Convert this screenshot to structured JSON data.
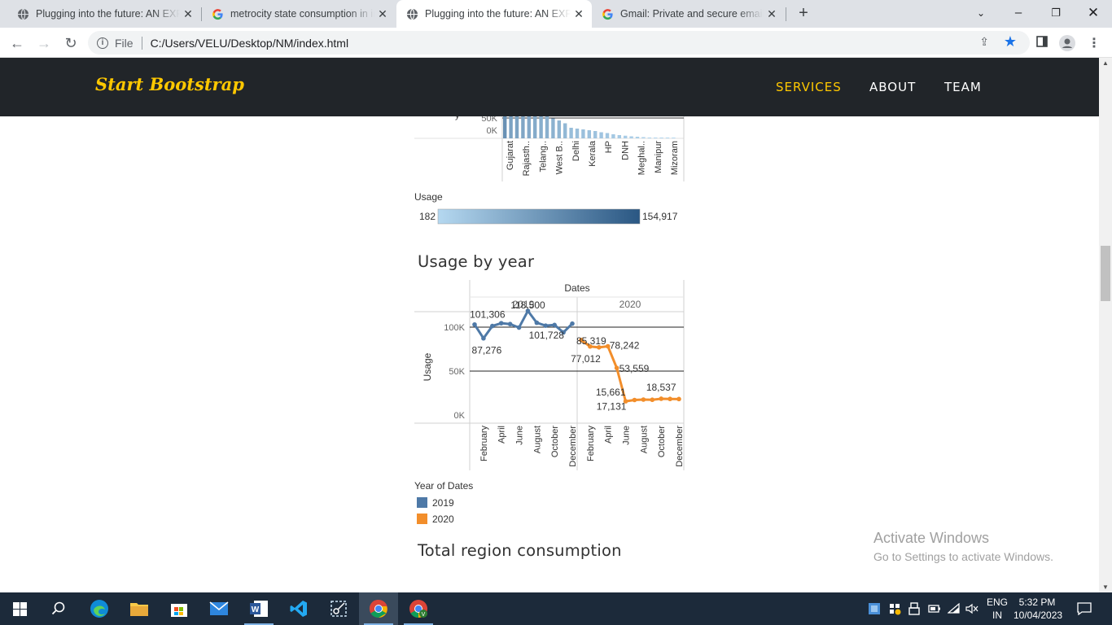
{
  "browser": {
    "tabs": [
      {
        "title": "Plugging into the future: AN EXPLORATION",
        "active": false,
        "favicon": "globe-icon"
      },
      {
        "title": "metrocity state consumption in india - Google Search",
        "active": false,
        "favicon": "google-icon"
      },
      {
        "title": "Plugging into the future: AN EXPLORATION",
        "active": true,
        "favicon": "globe-icon"
      },
      {
        "title": "Gmail: Private and secure email at no cost",
        "active": false,
        "favicon": "google-icon"
      }
    ],
    "address": {
      "scheme": "File",
      "url": "C:/Users/VELU/Desktop/NM/index.html"
    }
  },
  "site": {
    "brand": "Start Bootstrap",
    "nav": [
      {
        "label": "SERVICES",
        "active": true
      },
      {
        "label": "ABOUT",
        "active": false
      },
      {
        "label": "TEAM",
        "active": false
      }
    ]
  },
  "sections": {
    "usage_by_year_title": "Usage by year",
    "total_region_title": "Total region consumption"
  },
  "chart_data": [
    {
      "type": "bar",
      "partial": true,
      "categories": [
        "Gujarat",
        "Rajasth..",
        "Telang..",
        "West B..",
        "Delhi",
        "Kerala",
        "HP",
        "DNH",
        "Meghal..",
        "Manipur",
        "Mizoram"
      ],
      "all_bar_values": [
        154917,
        95000,
        91000,
        81000,
        72000,
        68000,
        61000,
        55000,
        49000,
        44000,
        37000,
        26000,
        24000,
        22000,
        20000,
        18000,
        15000,
        13000,
        10000,
        8000,
        6500,
        5000,
        4000,
        3000,
        1500,
        900,
        600,
        400,
        182
      ],
      "y_ticks_visible": [
        "50K",
        "0K"
      ],
      "legend": {
        "title": "Usage",
        "min_label": "182",
        "max_label": "154,917",
        "min": 182,
        "max": 154917,
        "color_low": "#b5d8f0",
        "color_high": "#2a5783"
      }
    },
    {
      "type": "line",
      "title": "Usage by year",
      "column_header": "Dates",
      "panels": [
        "2019",
        "2020"
      ],
      "ylabel": "Usage",
      "y_ticks": [
        "100K",
        "50K",
        "0K"
      ],
      "ylim": [
        0,
        130000
      ],
      "x_tick_labels": [
        "February",
        "April",
        "June",
        "August",
        "October",
        "December"
      ],
      "series": [
        {
          "name": "2019",
          "color": "#4e79a7",
          "months": [
            "Jan",
            "Feb",
            "Mar",
            "Apr",
            "May",
            "Jun",
            "Jul",
            "Aug",
            "Sep",
            "Oct",
            "Nov",
            "Dec"
          ],
          "values": [
            103000,
            87276,
            101306,
            104500,
            103500,
            99500,
            118500,
            105000,
            101728,
            102500,
            94000,
            104000
          ]
        },
        {
          "name": "2020",
          "color": "#f28e2b",
          "months": [
            "Jan",
            "Feb",
            "Mar",
            "Apr",
            "May",
            "Jun",
            "Jul",
            "Aug",
            "Sep",
            "Oct",
            "Nov",
            "Dec"
          ],
          "values": [
            85319,
            78000,
            77012,
            78242,
            53559,
            15661,
            17131,
            17600,
            17400,
            18537,
            18300,
            18200
          ]
        }
      ],
      "data_labels": [
        {
          "text": "101,306"
        },
        {
          "text": "118,500"
        },
        {
          "text": "87,276"
        },
        {
          "text": "101,728"
        },
        {
          "text": "85,319"
        },
        {
          "text": "77,012"
        },
        {
          "text": "78,242"
        },
        {
          "text": "53,559"
        },
        {
          "text": "15,661"
        },
        {
          "text": "17,131"
        },
        {
          "text": "18,537"
        }
      ],
      "legend": {
        "title": "Year of Dates",
        "items": [
          {
            "name": "2019",
            "color": "#4e79a7"
          },
          {
            "name": "2020",
            "color": "#f28e2b"
          }
        ]
      }
    }
  ],
  "watermark": {
    "line1": "Activate Windows",
    "line2": "Go to Settings to activate Windows."
  },
  "taskbar": {
    "apps": [
      "windows-start-icon",
      "search-icon",
      "edge-icon",
      "file-explorer-icon",
      "store-icon",
      "mail-icon",
      "word-icon",
      "vscode-icon",
      "snipping-icon",
      "chrome-icon",
      "chrome-profile-icon"
    ],
    "lang": [
      "ENG",
      "IN"
    ],
    "time": "5:32 PM",
    "date": "10/04/2023"
  }
}
